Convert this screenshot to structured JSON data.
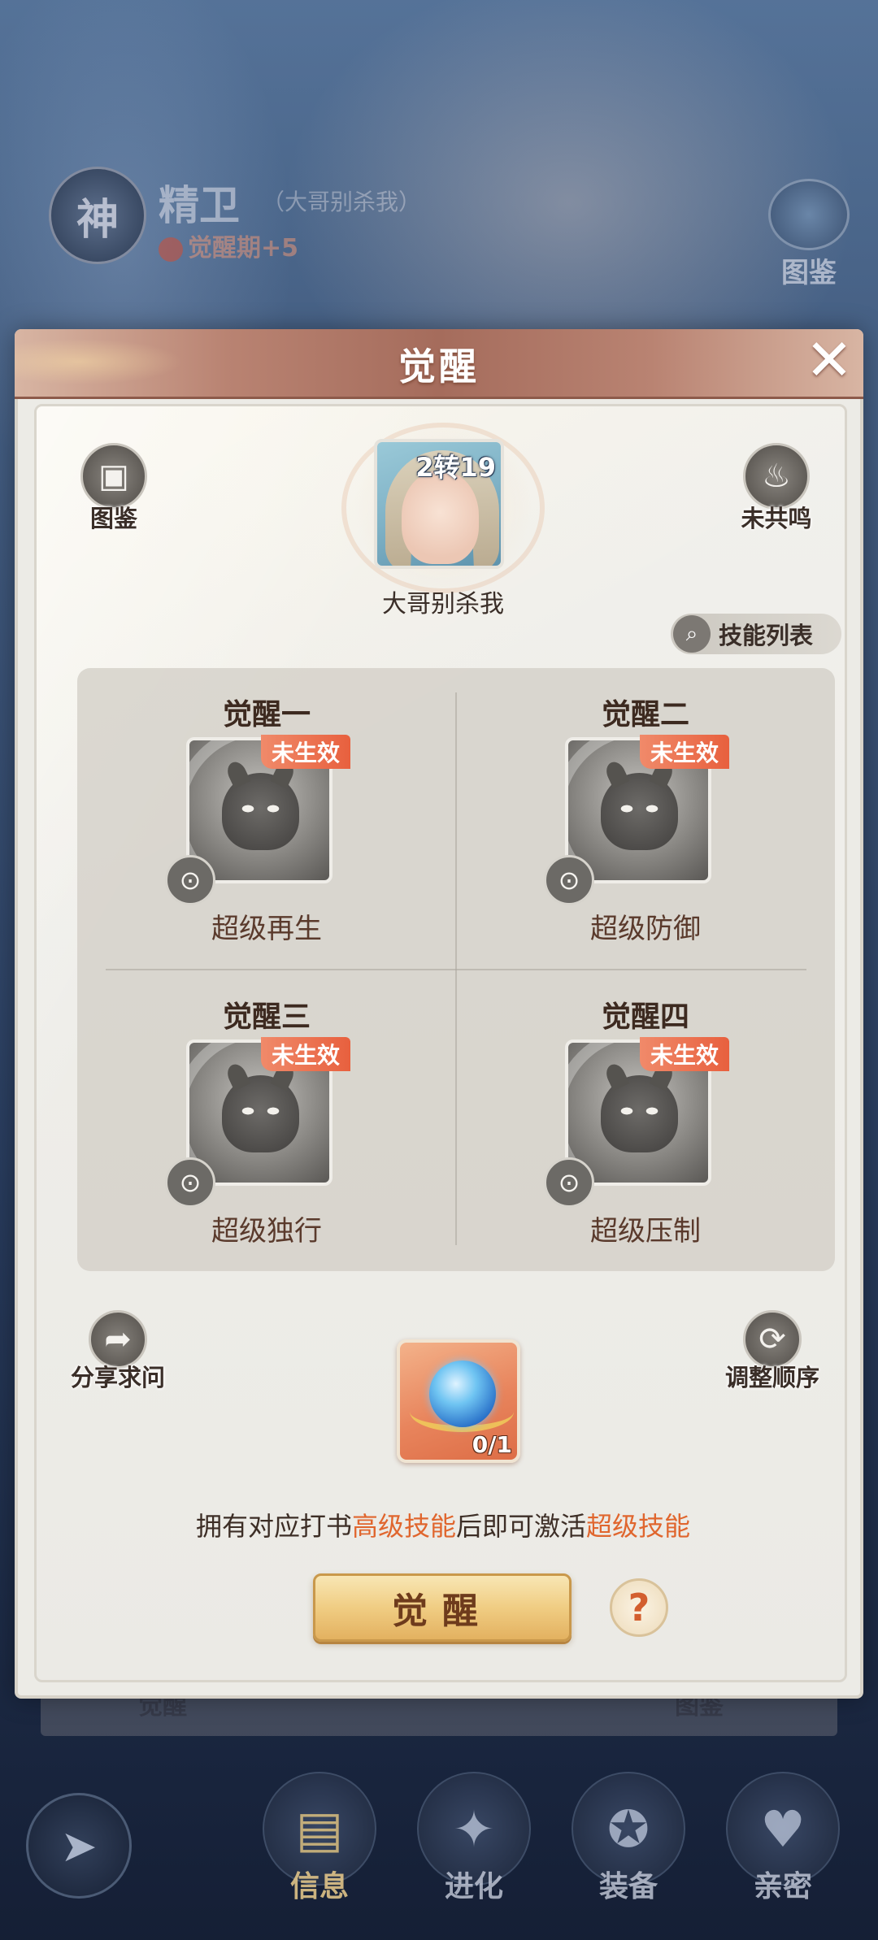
{
  "background": {
    "badge_char": "神",
    "hero_name": "精卫",
    "hero_subname": "（大哥别杀我）",
    "period": "觉醒期+5",
    "side_label": "图鉴",
    "strip_left": "觉醒",
    "strip_right": "图鉴"
  },
  "dialog": {
    "title": "觉醒",
    "close_icon": "✕",
    "codex_label": "图鉴",
    "resonance_label": "未共鸣",
    "hero": {
      "level": "2转19",
      "name": "大哥别杀我"
    },
    "skill_list_label": "技能列表",
    "inactive_badge": "未生效",
    "skills": [
      {
        "title": "觉醒一",
        "name": "超级再生"
      },
      {
        "title": "觉醒二",
        "name": "超级防御"
      },
      {
        "title": "觉醒三",
        "name": "超级独行"
      },
      {
        "title": "觉醒四",
        "name": "超级压制"
      }
    ],
    "share_label": "分享求问",
    "order_label": "调整顺序",
    "item_count": "0/1",
    "hint": {
      "p1": "拥有对应打书",
      "p2": "高级技能",
      "p3": "后即可激活",
      "p4": "超级技能"
    },
    "awaken_button": "觉醒",
    "help_icon": "?"
  },
  "nav": {
    "items": [
      {
        "label": "信息"
      },
      {
        "label": "进化"
      },
      {
        "label": "装备"
      },
      {
        "label": "亲密"
      }
    ]
  },
  "colors": {
    "accent_orange": "#e0662e",
    "title_bar": "#a56c5c",
    "badge": "#e8603e",
    "button_gold": "#f0cd83"
  }
}
